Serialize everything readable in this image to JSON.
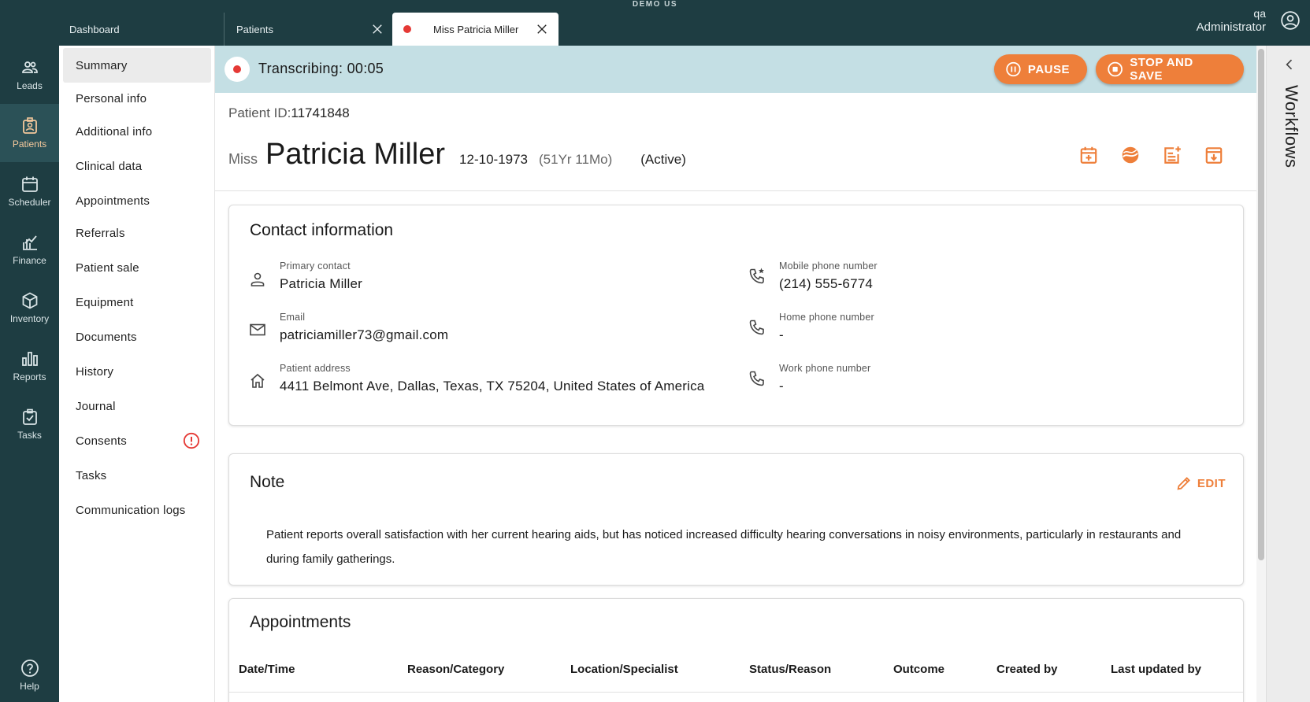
{
  "top": {
    "env": "DEMO US",
    "tabs": [
      {
        "label": "Dashboard"
      },
      {
        "label": "Patients"
      },
      {
        "label": "Miss Patricia Miller"
      }
    ],
    "user_line1": "qa",
    "user_line2": "Administrator"
  },
  "rail": {
    "items": [
      {
        "label": "Leads"
      },
      {
        "label": "Patients"
      },
      {
        "label": "Scheduler"
      },
      {
        "label": "Finance"
      },
      {
        "label": "Inventory"
      },
      {
        "label": "Reports"
      },
      {
        "label": "Tasks"
      }
    ],
    "help": "Help"
  },
  "subnav": {
    "items": [
      {
        "label": "Summary"
      },
      {
        "label": "Personal info"
      },
      {
        "label": "Additional info"
      },
      {
        "label": "Clinical data"
      },
      {
        "label": "Appointments"
      },
      {
        "label": "Referrals"
      },
      {
        "label": "Patient sale"
      },
      {
        "label": "Equipment"
      },
      {
        "label": "Documents"
      },
      {
        "label": "History"
      },
      {
        "label": "Journal"
      },
      {
        "label": "Consents"
      },
      {
        "label": "Tasks"
      },
      {
        "label": "Communication logs"
      }
    ]
  },
  "transcription": {
    "label": "Transcribing: 00:05",
    "pause": "PAUSE",
    "stop": "STOP AND SAVE"
  },
  "patient": {
    "id_label": "Patient ID:",
    "id": "11741848",
    "title": "Miss",
    "name": "Patricia Miller",
    "dob": "12-10-1973",
    "age": "(51Yr 11Mo)",
    "status": "(Active)"
  },
  "contact": {
    "title": "Contact information",
    "primary_label": "Primary contact",
    "primary_value": "Patricia Miller",
    "email_label": "Email",
    "email_value": "patriciamiller73@gmail.com",
    "address_label": "Patient address",
    "address_value": "4411 Belmont Ave, Dallas, Texas, TX 75204, United States of America",
    "mobile_label": "Mobile phone number",
    "mobile_value": "(214) 555-6774",
    "home_label": "Home phone number",
    "home_value": "-",
    "work_label": "Work phone number",
    "work_value": "-"
  },
  "note": {
    "title": "Note",
    "edit": "EDIT",
    "text": "Patient reports overall satisfaction with her current hearing aids, but has noticed increased difficulty hearing conversations in noisy environments, particularly in restaurants and during family gatherings."
  },
  "appointments": {
    "title": "Appointments",
    "columns": [
      "Date/Time",
      "Reason/Category",
      "Location/Specialist",
      "Status/Reason",
      "Outcome",
      "Created by",
      "Last updated by"
    ]
  },
  "workflows": {
    "label": "Workflows"
  },
  "colors": {
    "nav_bg": "#1e3d42",
    "accent": "#ee7f3a",
    "transcription_bg": "#c4dfe4",
    "recording": "#e53935"
  }
}
